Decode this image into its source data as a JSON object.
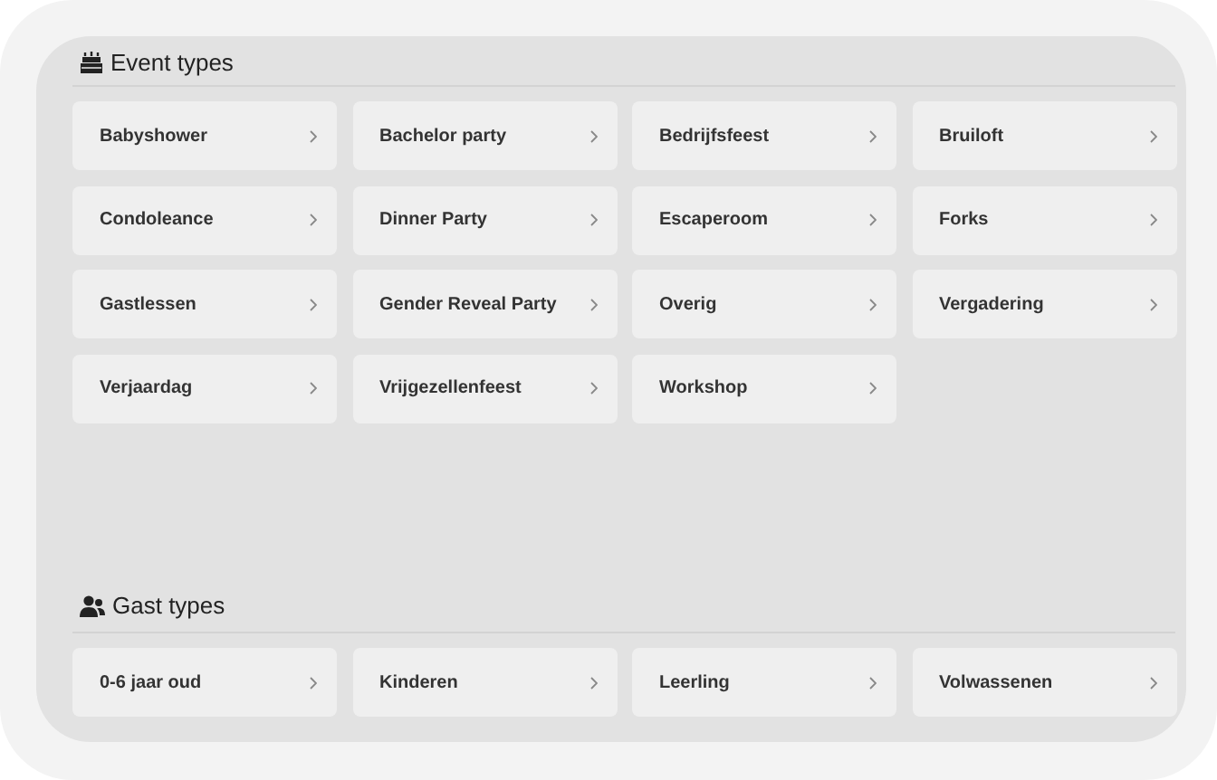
{
  "sections": [
    {
      "kind": "event",
      "title": "Event types",
      "items": [
        "Babyshower",
        "Bachelor party",
        "Bedrijfsfeest",
        "Bruiloft",
        "Condoleance",
        "Dinner Party",
        "Escaperoom",
        "Forks",
        "Gastlessen",
        "Gender Reveal Party",
        "Overig",
        "Vergadering",
        "Verjaardag",
        "Vrijgezellenfeest",
        "Workshop"
      ]
    },
    {
      "kind": "guest",
      "title": "Gast types",
      "items": [
        "0-6 jaar oud",
        "Kinderen",
        "Leerling",
        "Volwassenen"
      ]
    }
  ]
}
